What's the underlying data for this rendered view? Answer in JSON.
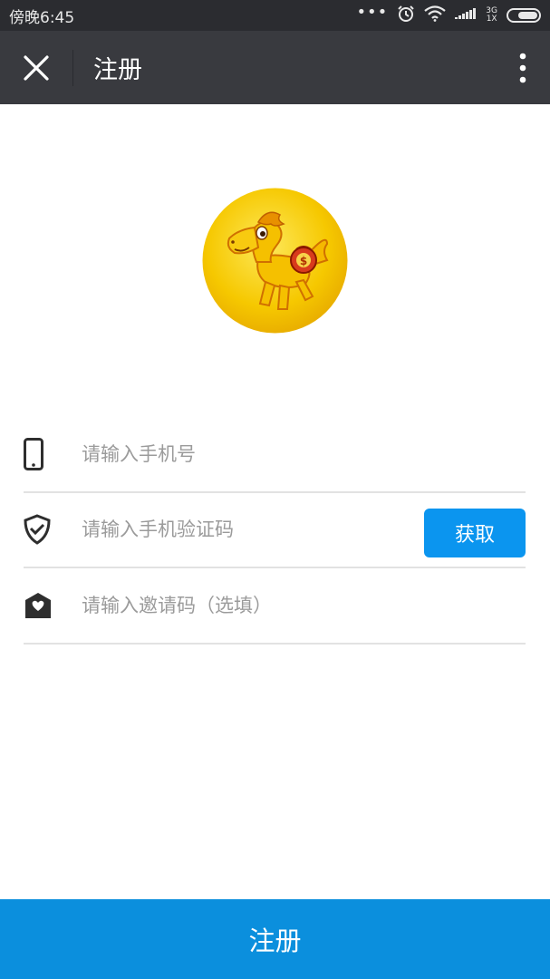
{
  "status_bar": {
    "time": "傍晚6:45",
    "network": [
      "3G",
      "1X"
    ]
  },
  "header": {
    "title": "注册"
  },
  "form": {
    "phone_placeholder": "请输入手机号",
    "code_placeholder": "请输入手机验证码",
    "get_code_label": "获取",
    "invite_placeholder": "请输入邀请码（选填）"
  },
  "footer": {
    "register_label": "注册"
  },
  "colors": {
    "status_bar": "#2b2c30",
    "title_bar": "#393a3f",
    "accent": "#0b95ef",
    "register": "#0b8fdd",
    "logo_gold": "#f5c400"
  },
  "icons": [
    "close-icon",
    "more-icon",
    "phone-icon",
    "shield-check-icon",
    "envelope-heart-icon",
    "wifi-icon",
    "alarm-icon",
    "signal-icon",
    "battery-icon"
  ]
}
